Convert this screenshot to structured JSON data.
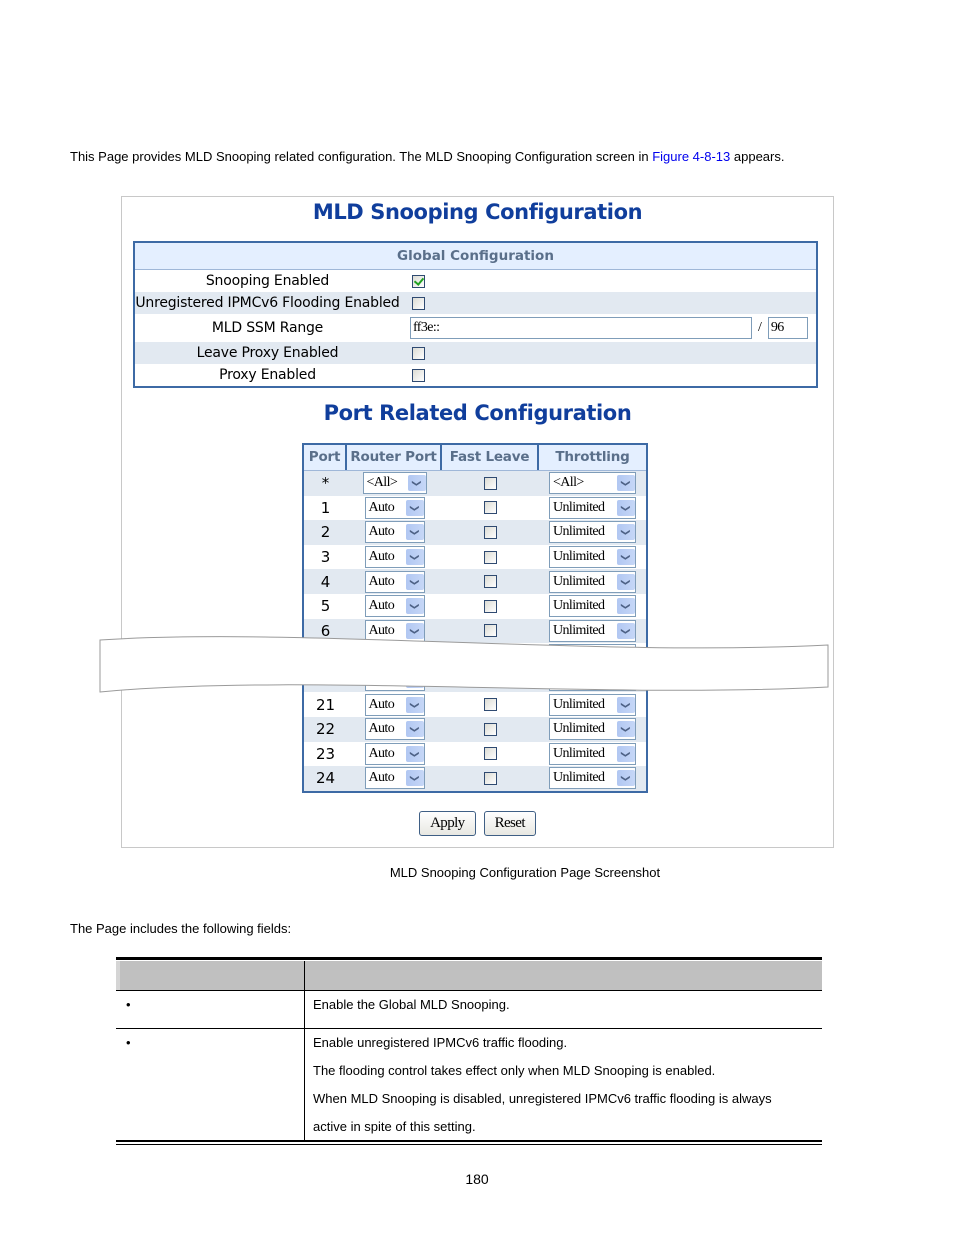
{
  "intro": {
    "text_before": "This Page provides MLD Snooping related configuration. The MLD Snooping Configuration screen in ",
    "link": "Figure 4-8-13",
    "text_after": " appears."
  },
  "screenshot": {
    "title": "MLD Snooping Configuration",
    "global": {
      "header": "Global Configuration",
      "rows": [
        {
          "label": "Snooping Enabled",
          "checked": true
        },
        {
          "label": "Unregistered IPMCv6 Flooding Enabled",
          "checked": false
        },
        {
          "label": "MLD SSM Range",
          "range_value": "ff3e::",
          "separator": "/",
          "prefix_length": "96"
        },
        {
          "label": "Leave Proxy Enabled",
          "checked": false
        },
        {
          "label": "Proxy Enabled",
          "checked": false
        }
      ]
    },
    "port_title": "Port Related Configuration",
    "port_table": {
      "headers": [
        "Port",
        "Router Port",
        "Fast Leave",
        "Throttling"
      ],
      "rows": [
        {
          "port": "*",
          "router_port": "<All>",
          "fast_leave": false,
          "throttling": "<All>"
        },
        {
          "port": "1",
          "router_port": "Auto",
          "fast_leave": false,
          "throttling": "Unlimited"
        },
        {
          "port": "2",
          "router_port": "Auto",
          "fast_leave": false,
          "throttling": "Unlimited"
        },
        {
          "port": "3",
          "router_port": "Auto",
          "fast_leave": false,
          "throttling": "Unlimited"
        },
        {
          "port": "4",
          "router_port": "Auto",
          "fast_leave": false,
          "throttling": "Unlimited"
        },
        {
          "port": "5",
          "router_port": "Auto",
          "fast_leave": false,
          "throttling": "Unlimited"
        },
        {
          "port": "6",
          "router_port": "Auto",
          "fast_leave": false,
          "throttling": "Unlimited"
        },
        {
          "port": "...",
          "router_port": "",
          "fast_leave": false,
          "throttling": ""
        },
        {
          "port": "",
          "router_port": "",
          "fast_leave": false,
          "throttling": ""
        },
        {
          "port": "21",
          "router_port": "Auto",
          "fast_leave": false,
          "throttling": "Unlimited"
        },
        {
          "port": "22",
          "router_port": "Auto",
          "fast_leave": false,
          "throttling": "Unlimited"
        },
        {
          "port": "23",
          "router_port": "Auto",
          "fast_leave": false,
          "throttling": "Unlimited"
        },
        {
          "port": "24",
          "router_port": "Auto",
          "fast_leave": false,
          "throttling": "Unlimited"
        }
      ]
    },
    "buttons": {
      "apply": "Apply",
      "reset": "Reset"
    }
  },
  "caption": "MLD Snooping Configuration Page Screenshot",
  "fields_intro": "The Page includes the following fields:",
  "fields_table": {
    "rows": [
      {
        "bullet": "•",
        "description": [
          "Enable the Global MLD Snooping."
        ]
      },
      {
        "bullet": "•",
        "description": [
          "Enable unregistered IPMCv6 traffic flooding.",
          "The flooding control takes effect only when MLD Snooping is enabled.",
          "When MLD Snooping is disabled, unregistered IPMCv6 traffic flooding is always",
          "active in spite of this setting."
        ]
      }
    ]
  },
  "page_number": "180"
}
